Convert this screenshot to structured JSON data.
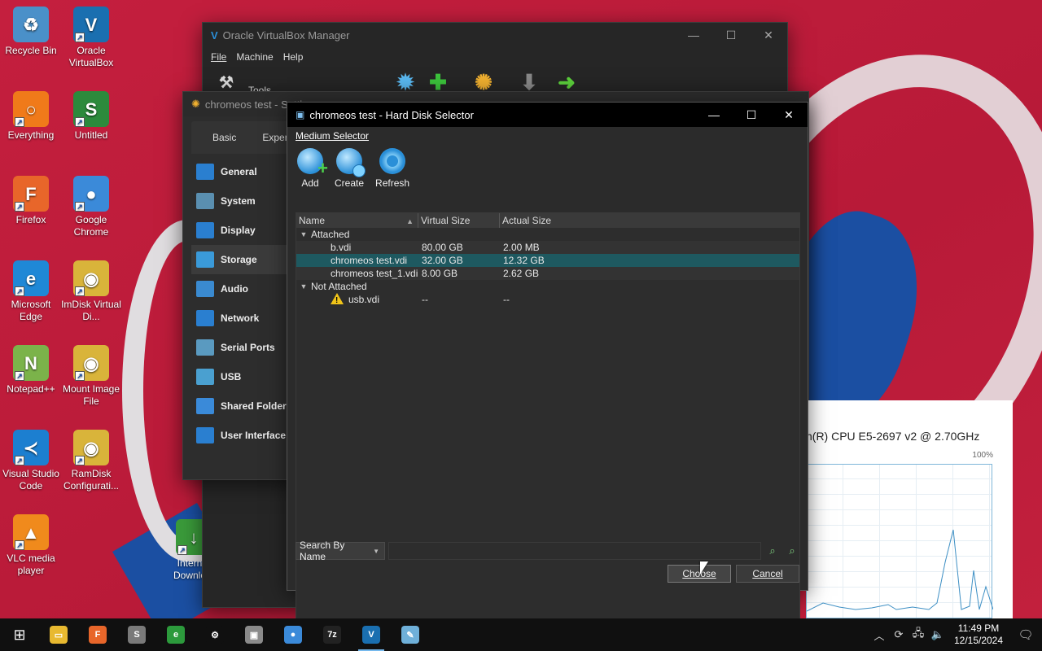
{
  "desktop": {
    "icons": [
      {
        "label": "Recycle Bin",
        "icon": "recycle-bin-icon",
        "color": "#4a90c9",
        "glyph": "♻"
      },
      {
        "label": "Oracle VirtualBox",
        "icon": "virtualbox-icon",
        "color": "#1a6fb0",
        "glyph": "V"
      },
      {
        "label": "Everything",
        "icon": "everything-icon",
        "color": "#f07a1a",
        "glyph": "○"
      },
      {
        "label": "Untitled",
        "icon": "sprite-icon",
        "color": "#2c8a3c",
        "glyph": "S"
      },
      {
        "label": "Firefox",
        "icon": "firefox-icon",
        "color": "#e8662a",
        "glyph": "F"
      },
      {
        "label": "Google Chrome",
        "icon": "chrome-icon",
        "color": "#3b8ad9",
        "glyph": "●"
      },
      {
        "label": "Microsoft Edge",
        "icon": "edge-icon",
        "color": "#1f88d6",
        "glyph": "e"
      },
      {
        "label": "ImDisk Virtual Di...",
        "icon": "imdisk-icon",
        "color": "#d9b43a",
        "glyph": "◉"
      },
      {
        "label": "Notepad++",
        "icon": "notepadpp-icon",
        "color": "#7bb34a",
        "glyph": "N"
      },
      {
        "label": "Mount Image File",
        "icon": "mount-image-icon",
        "color": "#d9b43a",
        "glyph": "◉"
      },
      {
        "label": "Visual Studio Code",
        "icon": "vscode-icon",
        "color": "#1c7fd0",
        "glyph": "≺"
      },
      {
        "label": "RamDisk Configurati...",
        "icon": "ramdisk-icon",
        "color": "#d9b43a",
        "glyph": "◉"
      },
      {
        "label": "VLC media player",
        "icon": "vlc-icon",
        "color": "#f08a1c",
        "glyph": "▲"
      },
      {
        "label": "Internet Downlo...",
        "icon": "idm-icon",
        "color": "#3a9a3a",
        "glyph": "↓"
      }
    ]
  },
  "vbox_manager": {
    "title": "Oracle VirtualBox Manager",
    "menu": [
      "File",
      "Machine",
      "Help"
    ],
    "tools_label": "Tools"
  },
  "settings": {
    "title": "chromeos test - Settings",
    "tabs": [
      "Basic",
      "Expert"
    ],
    "sections": [
      {
        "label": "General",
        "color": "#2a7fd0"
      },
      {
        "label": "System",
        "color": "#5a8fb0"
      },
      {
        "label": "Display",
        "color": "#2a7fd0"
      },
      {
        "label": "Storage",
        "color": "#3a9ad9"
      },
      {
        "label": "Audio",
        "color": "#3a8ad0"
      },
      {
        "label": "Network",
        "color": "#2a7fd0"
      },
      {
        "label": "Serial Ports",
        "color": "#5a9ac0"
      },
      {
        "label": "USB",
        "color": "#4aa0d0"
      },
      {
        "label": "Shared Folders",
        "color": "#3a8ad9"
      },
      {
        "label": "User Interface",
        "color": "#2a7fd0"
      }
    ],
    "active_section": "Storage"
  },
  "hard_disk_selector": {
    "title": "chromeos test - Hard Disk Selector",
    "menu": "Medium Selector",
    "tools": [
      {
        "label": "Add",
        "icon": "add-disk-icon"
      },
      {
        "label": "Create",
        "icon": "create-disk-icon"
      },
      {
        "label": "Refresh",
        "icon": "refresh-icon"
      }
    ],
    "columns": [
      "Name",
      "Virtual Size",
      "Actual Size"
    ],
    "groups": [
      {
        "label": "Attached",
        "rows": [
          {
            "name": "b.vdi",
            "virtual": "80.00 GB",
            "actual": "2.00 MB",
            "selected": false
          },
          {
            "name": "chromeos test.vdi",
            "virtual": "32.00 GB",
            "actual": "12.32 GB",
            "selected": true
          },
          {
            "name": "chromeos test_1.vdi",
            "virtual": "8.00 GB",
            "actual": "2.62 GB",
            "selected": false
          }
        ]
      },
      {
        "label": "Not Attached",
        "rows": [
          {
            "name": "usb.vdi",
            "virtual": "--",
            "actual": "--",
            "selected": false,
            "warning": true
          }
        ]
      }
    ],
    "search_mode": "Search By Name",
    "search_value": "",
    "choose_label": "Choose",
    "cancel_label": "Cancel"
  },
  "task_manager": {
    "cpu_name": "n(R) CPU E5-2697 v2 @ 2.70GHz",
    "max_label": "100%"
  },
  "taskbar": {
    "apps": [
      {
        "icon": "file-explorer-icon",
        "color": "#e8b930",
        "glyph": "▭",
        "running": false
      },
      {
        "icon": "firefox-icon",
        "color": "#e8662a",
        "glyph": "F",
        "running": false
      },
      {
        "icon": "sprite-icon",
        "color": "#7a7a7a",
        "glyph": "S",
        "running": false
      },
      {
        "icon": "edge-globe-icon",
        "color": "#2c9a3c",
        "glyph": "e",
        "running": false
      },
      {
        "icon": "settings-icon",
        "color": "#101010",
        "glyph": "⚙",
        "running": false
      },
      {
        "icon": "devices-icon",
        "color": "#8a8a8a",
        "glyph": "▣",
        "running": false
      },
      {
        "icon": "chrome-icon",
        "color": "#3b8ad9",
        "glyph": "●",
        "running": false
      },
      {
        "icon": "7zip-icon",
        "color": "#222",
        "glyph": "7z",
        "running": false
      },
      {
        "icon": "virtualbox-icon",
        "color": "#1a6fb0",
        "glyph": "V",
        "running": true
      },
      {
        "icon": "notepad-icon",
        "color": "#6fb0d9",
        "glyph": "✎",
        "running": false
      }
    ],
    "time": "11:49 PM",
    "date": "12/15/2024"
  }
}
